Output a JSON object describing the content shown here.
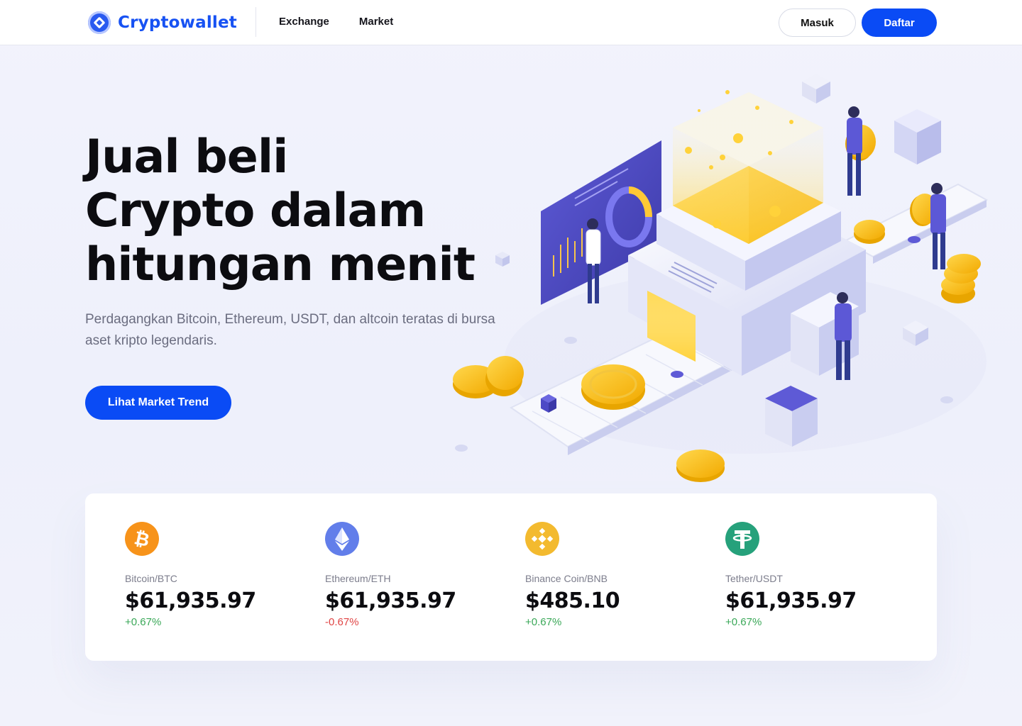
{
  "nav": {
    "brand": "Cryptowallet",
    "links": [
      "Exchange",
      "Market"
    ],
    "login_label": "Masuk",
    "register_label": "Daftar"
  },
  "hero": {
    "title_lines": [
      "Jual beli",
      "Crypto dalam",
      "hitungan menit"
    ],
    "subtitle": "Perdagangkan Bitcoin, Ethereum, USDT, dan altcoin teratas di bursa aset kripto legendaris.",
    "cta_label": "Lihat Market Trend"
  },
  "colors": {
    "primary": "#0a4bf5",
    "brand_text": "#1752f3",
    "up": "#3aa858",
    "down": "#e04444",
    "btc": "#f7931a",
    "eth": "#627eea",
    "bnb": "#f3ba2f",
    "usdt": "#26a17b"
  },
  "tickers": [
    {
      "icon": "bitcoin-icon",
      "pair": "Bitcoin/BTC",
      "price": "$61,935.97",
      "change": "+0.67%",
      "direction": "up"
    },
    {
      "icon": "ethereum-icon",
      "pair": "Ethereum/ETH",
      "price": "$61,935.97",
      "change": "-0.67%",
      "direction": "down"
    },
    {
      "icon": "binance-coin-icon",
      "pair": "Binance Coin/BNB",
      "price": "$485.10",
      "change": "+0.67%",
      "direction": "up"
    },
    {
      "icon": "tether-icon",
      "pair": "Tether/USDT",
      "price": "$61,935.97",
      "change": "+0.67%",
      "direction": "up"
    }
  ]
}
